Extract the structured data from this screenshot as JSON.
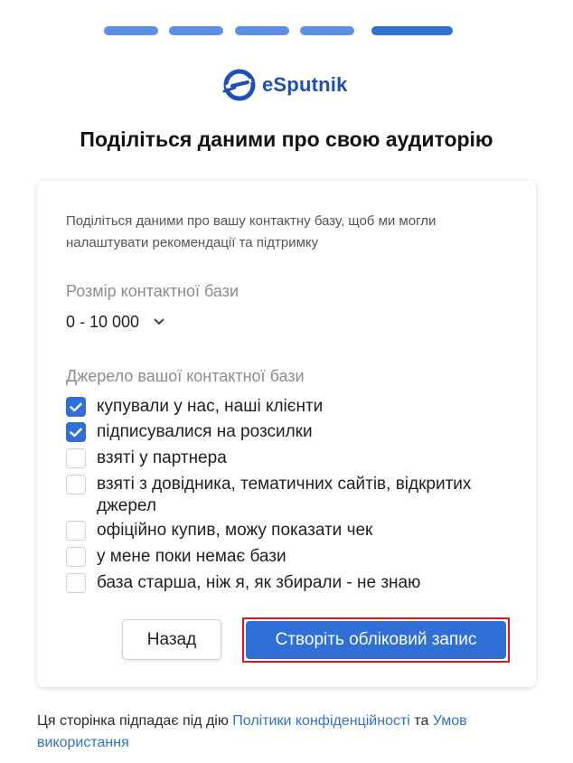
{
  "progress": {
    "total_steps": 5,
    "current_step": 5
  },
  "brand": {
    "name": "eSputnik",
    "icon": "esputnik-logo-icon",
    "color": "#1f4fb4"
  },
  "page": {
    "title": "Поділіться даними про свою аудиторію"
  },
  "form": {
    "intro": "Поділіться даними про вашу контактну базу, щоб ми могли налаштувати рекомендації та підтримку",
    "size_label": "Розмір контактної бази",
    "size_value": "0 - 10 000",
    "source_label": "Джерело вашої контактної бази",
    "options": [
      {
        "label": "купували у нас, наші клієнти",
        "checked": true
      },
      {
        "label": "підписувалися на розсилки",
        "checked": true
      },
      {
        "label": "взяті у партнера",
        "checked": false
      },
      {
        "label": "взяті з довідника, тематичних сайтів, відкритих джерел",
        "checked": false
      },
      {
        "label": "офіційно купив, можу показати чек",
        "checked": false
      },
      {
        "label": "у мене поки немає бази",
        "checked": false
      },
      {
        "label": "база старша, ніж я, як збирали - не знаю",
        "checked": false
      }
    ],
    "back_label": "Назад",
    "create_label": "Створіть обліковий запис"
  },
  "footer": {
    "prefix": "Ця сторінка підпадає під дію",
    "privacy_link": "Політики конфіденційності",
    "conj": "та",
    "terms_link": "Умов використання"
  },
  "colors": {
    "accent": "#2f6fd6",
    "progress": "#5b8fe8",
    "highlight_border": "#e0141b"
  }
}
